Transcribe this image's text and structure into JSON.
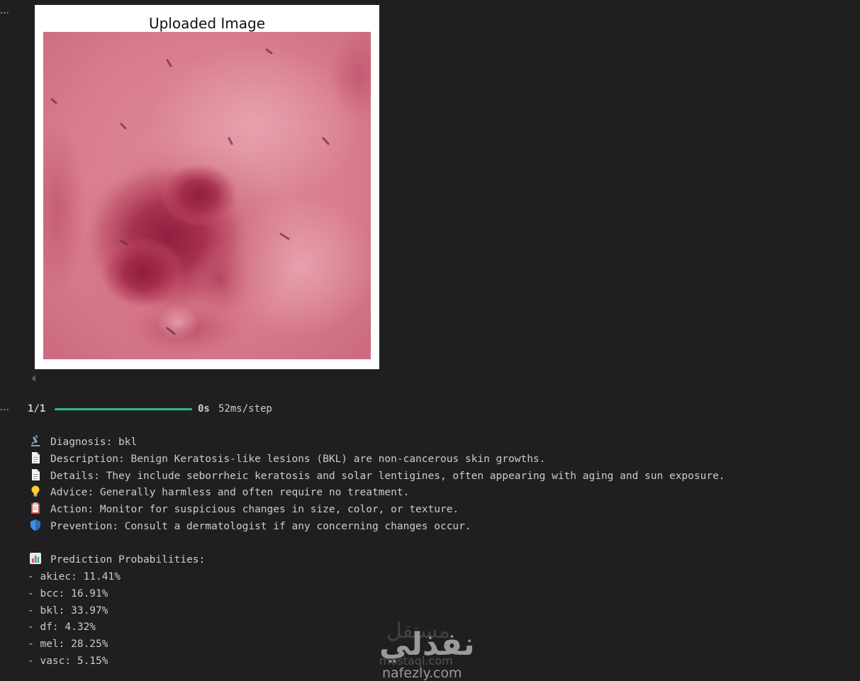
{
  "figure": {
    "title": "Uploaded Image"
  },
  "progress": {
    "count": "1/1",
    "fraction": 1.0,
    "time": "0s",
    "step": "52ms/step"
  },
  "result": {
    "diagnosis": "Diagnosis: bkl",
    "description": "Description: Benign Keratosis-like lesions (BKL) are non-cancerous skin growths.",
    "details": "Details: They include seborrheic keratosis and solar lentigines, often appearing with aging and sun exposure.",
    "advice": "Advice: Generally harmless and often require no treatment.",
    "action": "Action: Monitor for suspicious changes in size, color, or texture.",
    "prevention": "Prevention: Consult a dermatologist if any concerning changes occur.",
    "probabilities_header": "Prediction Probabilities:",
    "probabilities": [
      "- akiec: 11.41%",
      "- bcc: 16.91%",
      "- bkl: 33.97%",
      "- df: 4.32%",
      "- mel: 28.25%",
      "- vasc: 5.15%"
    ]
  },
  "icons": {
    "diagnosis": "microscope-icon",
    "description": "document-icon",
    "details": "document-icon",
    "advice": "lightbulb-icon",
    "action": "clipboard-icon",
    "prevention": "shield-icon",
    "probabilities": "bar-chart-icon"
  },
  "colors": {
    "background": "#1f1f1f",
    "progress": "#2ebd7f",
    "text": "#cccccc"
  },
  "watermark": {
    "arabic": "نفذلي",
    "arabic_faint": "مستقل",
    "faint_text": "mostaql.com",
    "site": "nafezly.com"
  }
}
